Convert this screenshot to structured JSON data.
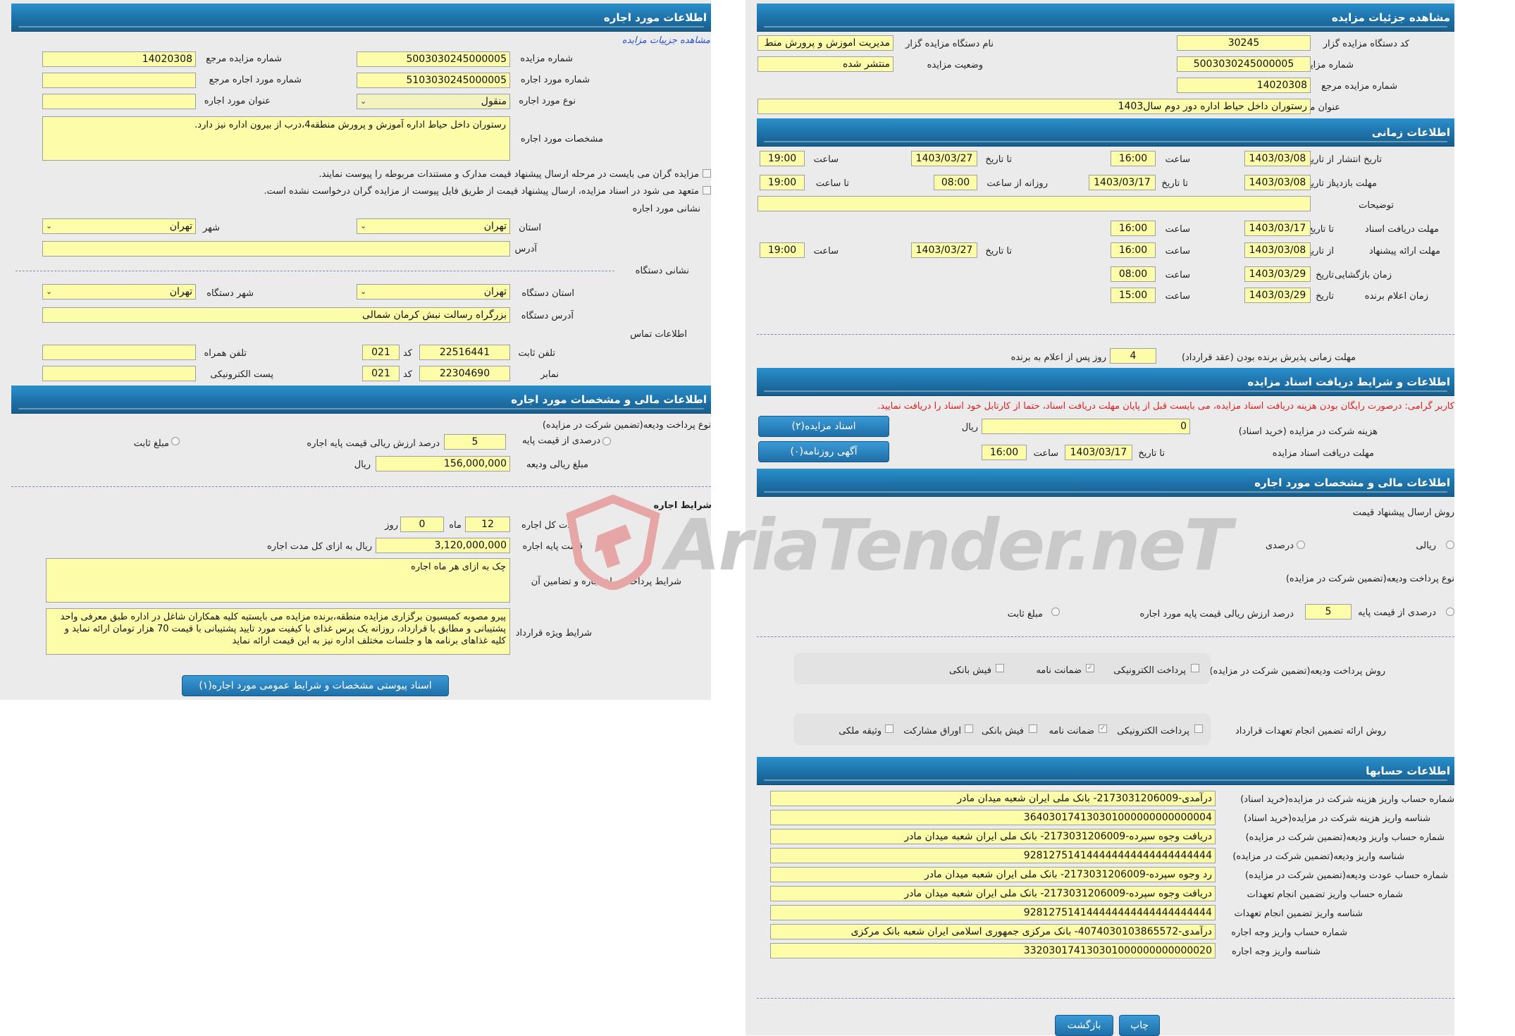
{
  "left": {
    "lease_details_title": "اطلاعات مورد اجاره",
    "view_auction_link": "مشاهده جزییات مزایده",
    "auction_no_label": "شماره مزایده",
    "auction_no": "5003030245000005",
    "ref_auction_no_label": "شماره مزایده مرجع",
    "ref_auction_no": "14020308",
    "lease_item_no_label": "شماره مورد اجاره",
    "lease_item_no": "5103030245000005",
    "ref_lease_item_no_label": "شماره مورد اجاره مرجع",
    "ref_lease_item_no": "",
    "lease_type_label": "نوع مورد اجاره",
    "lease_type": "منقول",
    "lease_title_label": "عنوان مورد اجاره",
    "lease_title": "",
    "lease_specs_label": "مشخصات مورد اجاره",
    "lease_specs": "رستوران داخل حیاط اداره آموزش و پرورش منطقه4،درب از بیرون اداره نیز دارد.",
    "note1": "مزایده گران می بایست در مرحله ارسال پیشنهاد قیمت مدارک و مستندات مربوطه را پیوست نمایند.",
    "note2": "متعهد می شود در اسناد مزایده، ارسال پیشنهاد قیمت از طریق فایل پیوست از مزایده گران درخواست نشده است.",
    "lease_address_section": "نشانی مورد اجاره",
    "province_label": "استان",
    "province": "تهران",
    "city_label": "شهر",
    "city": "تهران",
    "address_label": "آدرس",
    "address": "",
    "org_address_section": "نشانی دستگاه",
    "org_province_label": "استان دستگاه",
    "org_province": "تهران",
    "org_city_label": "شهر دستگاه",
    "org_city": "تهران",
    "org_address_label": "آدرس دستگاه",
    "org_address": "بزرگراه رسالت نبش کرمان شمالی",
    "contact_section": "اطلاعات تماس",
    "phone_label": "تلفن ثابت",
    "phone": "22516441",
    "code_label": "کد",
    "phone_code": "021",
    "mobile_label": "تلفن همراه",
    "mobile": "",
    "fax_label": "نمابر",
    "fax": "22304690",
    "fax_code": "021",
    "email_label": "پست الکترونیکی",
    "email": "",
    "financial_title": "اطلاعات مالی و مشخصات مورد اجاره",
    "deposit_type_label": "نوع پرداخت ودیعه(تضمین شرکت در مزایده)",
    "percent_of_base_label": "درصدی از قیمت پایه",
    "percent_value": "5",
    "percent_suffix": "درصد ارزش ریالی قیمت پایه اجاره",
    "fixed_amount_label": "مبلغ ثابت",
    "deposit_amount_label": "مبلغ ریالی ودیعه",
    "deposit_amount": "156,000,000",
    "rial": "ریال",
    "lease_conditions_section": "شرایط اجاره",
    "duration_label": "مدت کل اجاره",
    "duration_months": "12",
    "month_label": "ماه",
    "duration_days": "0",
    "day_label": "روز",
    "base_price_label": "قیمت پایه اجاره",
    "base_price": "3,120,000,000",
    "base_price_suffix": "ریال به ازای کل مدت اجاره",
    "payment_terms_label": "شرایط پرداخت مبلغ اجاره و تضامین آن",
    "payment_terms": "چک به ازای هر ماه اجاره",
    "special_terms_label": "شرایط ویژه قرارداد",
    "special_terms": "پیرو مصوبه کمیسیون برگزاری مزایده منطقه،برنده مزایده می بایستیه کلیه همکاران شاغل در اداره طبق معرفی واحد پشتیبانی و مطابق با قرارداد، روزانه یک پرس غذای با کیفیت مورد تایید پشتیبانی با قیمت 70 هزار تومان ارائه نماید و کلیه غذاهای برنامه ها و جلسات مختلف اداره نیز به این قیمت ارائه نماید",
    "attachment_button": "اسناد پیوستی مشخصات و شرایط عمومی مورد اجاره(۱)"
  },
  "right": {
    "auction_details_title": "مشاهده جزئیات مزایده",
    "org_code_label": "کد دستگاه مزایده گزار",
    "org_code": "30245",
    "org_name_label": "نام دستگاه مزایده گزار",
    "org_name": "مدیریت اموزش و پرورش منط",
    "auction_no_label": "شماره مزایده",
    "auction_no": "5003030245000005",
    "status_label": "وضعیت مزایده",
    "status": "منتشر شده",
    "ref_no_label": "شماره مزایده مرجع",
    "ref_no": "14020308",
    "auction_title_label": "عنوان مزایده",
    "auction_title": "رستوران داخل حیاط اداره دور دوم سال1403",
    "timing_title": "اطلاعات زمانی",
    "publish_label": "تاریخ انتشار",
    "from_date_label": "از تاریخ",
    "to_date_label": "تا تاریخ",
    "time_label": "ساعت",
    "publish_from": "1403/03/08",
    "publish_from_time": "16:00",
    "publish_to": "1403/03/27",
    "publish_to_time": "19:00",
    "visit_label": "مهلت بازدید",
    "visit_from": "1403/03/08",
    "visit_to": "1403/03/17",
    "daily_from_label": "روزانه از ساعت",
    "visit_daily_from": "08:00",
    "to_time_label": "تا ساعت",
    "visit_daily_to": "19:00",
    "notes_label": "توضیحات",
    "notes": "",
    "doc_deadline_label": "مهلت دریافت اسناد",
    "doc_deadline_date": "1403/03/17",
    "doc_deadline_time": "16:00",
    "offer_deadline_label": "مهلت ارائه پیشنهاد",
    "offer_from": "1403/03/08",
    "offer_from_time": "16:00",
    "offer_to": "1403/03/27",
    "offer_to_time": "19:00",
    "opening_label": "زمان بازگشایی",
    "date_label": "تاریخ",
    "opening_date": "1403/03/29",
    "opening_time": "08:00",
    "winner_label": "زمان اعلام برنده",
    "winner_date": "1403/03/29",
    "winner_time": "15:00",
    "acceptance_label": "مهلت زمانی پذیرش برنده بودن (عقد قرارداد)",
    "acceptance_days": "4",
    "acceptance_suffix": "روز پس از اعلام به برنده",
    "docs_title": "اطلاعات و شرایط دریافت اسناد مزایده",
    "docs_notice": "کاربر گرامی: درصورت رایگان بودن هزینه دریافت اسناد مزایده، می بایست قبل از پایان مهلت دریافت اسناد، حتما از کارتابل خود اسناد را دریافت نمایید.",
    "fee_label": "هزینه شرکت در مزایده (خرید اسناد)",
    "fee": "0",
    "rial": "ریال",
    "docs_button": "اسناد مزایده(۲)",
    "docs_deadline_label": "مهلت دریافت اسناد مزایده",
    "docs_deadline_date": "1403/03/17",
    "docs_deadline_time": "16:00",
    "newspaper_button": "آگهی روزنامه(۰)",
    "financial_title": "اطلاعات مالی و مشخصات مورد اجاره",
    "offer_method_label": "روش ارسال پیشنهاد قیمت",
    "rial_option": "ریالی",
    "percent_option": "درصدی",
    "deposit_type_label": "نوع پرداخت ودیعه(تضمین شرکت در مزایده)",
    "percent_of_base_label": "درصدی از قیمت پایه",
    "percent_value": "5",
    "percent_suffix": "درصد ارزش ریالی قیمت پایه مورد اجاره",
    "fixed_amount_label": "مبلغ ثابت",
    "deposit_method_label": "روش پرداخت ودیعه(تضمین شرکت در مزایده)",
    "electronic_payment": "پرداخت الکترونیکی",
    "guarantee": "ضمانت نامه",
    "bank_receipt": "فیش بانکی",
    "contract_guarantee_label": "روش ارائه تضمین انجام تعهدات قرارداد",
    "participation_bonds": "اوراق مشارکت",
    "property_collateral": "وثیقه ملکی",
    "accounts_title": "اطلاعات حسابها",
    "accounts": [
      {
        "label": "شماره حساب واریز هزینه شرکت در مزایده(خرید اسناد)",
        "value": "درآمدی-2173031206009- بانک ملی ایران شعبه میدان مادر"
      },
      {
        "label": "شناسه واریز هزینه شرکت در مزایده(خرید اسناد)",
        "value": "364030174130301000000000000004"
      },
      {
        "label": "شماره حساب واریز ودیعه(تضمین شرکت در مزایده)",
        "value": "دریافت وجوه سپرده-2173031206009- بانک ملی ایران شعبه میدان مادر"
      },
      {
        "label": "شناسه واریز ودیعه(تضمین شرکت در مزایده)",
        "value": "928127514144444444444444444444"
      },
      {
        "label": "شماره حساب عودت ودیعه(تضمین شرکت در مزایده)",
        "value": "رد وجوه سپرده-2173031206009- بانک ملی ایران شعبه میدان مادر"
      },
      {
        "label": "شماره حساب واریز تضمین انجام تعهدات",
        "value": "دریافت وجوه سپرده-2173031206009- بانک ملی ایران شعبه میدان مادر"
      },
      {
        "label": "شناسه واریز تضمین انجام تعهدات",
        "value": "928127514144444444444444444444"
      },
      {
        "label": "شماره حساب واریز وجه اجاره",
        "value": "درآمدی-4074030103865572- بانک مرکزی جمهوری اسلامی ایران شعبه بانک مرکزی"
      },
      {
        "label": "شناسه واریز وجه اجاره",
        "value": "332030174130301000000000000020"
      }
    ],
    "print_button": "چاپ",
    "back_button": "بازگشت"
  },
  "watermark": "AriaTender.neT",
  "colors": {
    "field_bg": "#fdfda9",
    "header_blue": "#1d6fa5",
    "panel_gray": "#ebebeb",
    "notice_red": "#e02020"
  }
}
